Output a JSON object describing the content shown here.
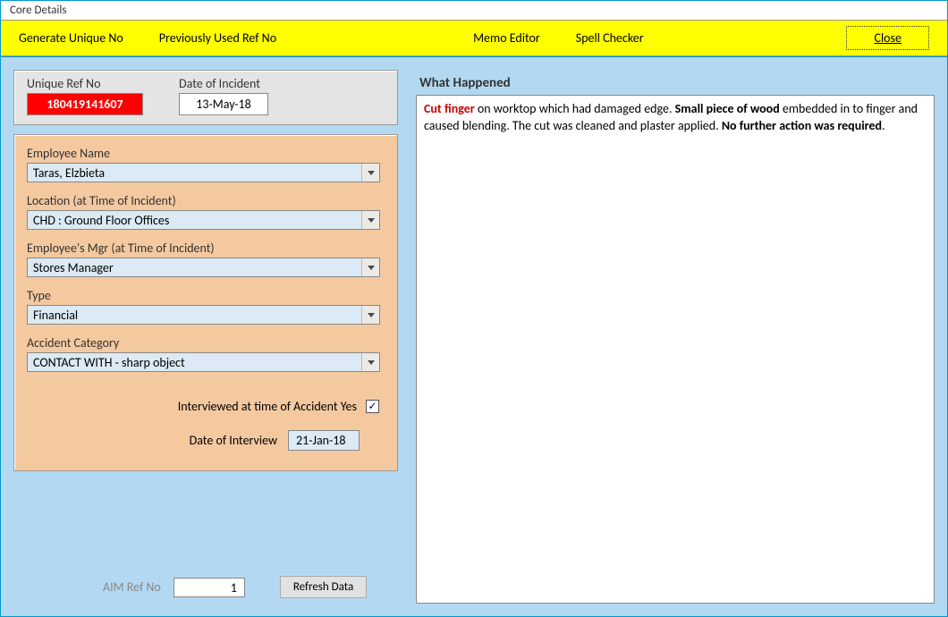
{
  "window": {
    "title": "Core Details"
  },
  "toolbar": {
    "generate": "Generate Unique No",
    "previous": "Previously Used Ref No",
    "memo": "Memo Editor",
    "spell": "Spell Checker",
    "close": "Close"
  },
  "ref": {
    "unique_label": "Unique Ref No",
    "unique_value": "180419141607",
    "date_label": "Date of Incident",
    "date_value": "13-May-18"
  },
  "form": {
    "employee_label": "Employee Name",
    "employee_value": "Taras, Elzbieta",
    "location_label": "Location (at Time of Incident)",
    "location_value": "CHD : Ground Floor Offices",
    "manager_label": "Employee's Mgr (at Time of Incident)",
    "manager_value": "Stores Manager",
    "type_label": "Type",
    "type_value": "Financial",
    "category_label": "Accident Category",
    "category_value": "CONTACT WITH - sharp object",
    "interview_check_label": "Interviewed at time of Accident Yes",
    "interview_checked": "✓",
    "interview_date_label": "Date of Interview",
    "interview_date_value": "21-Jan-18"
  },
  "bottom": {
    "aim_label": "AIM Ref No",
    "aim_value": "1",
    "refresh": "Refresh Data"
  },
  "whatHappened": {
    "title": "What Happened",
    "seg1_bold_red": "Cut finger",
    "seg2": " on  worktop which had damaged edge.  ",
    "seg3_bold": "Small piece of wood",
    "seg4": " embedded in to finger and caused blending.  The cut was cleaned and plaster applied.  ",
    "seg5_bold": "No further action was required",
    "seg6": "."
  }
}
